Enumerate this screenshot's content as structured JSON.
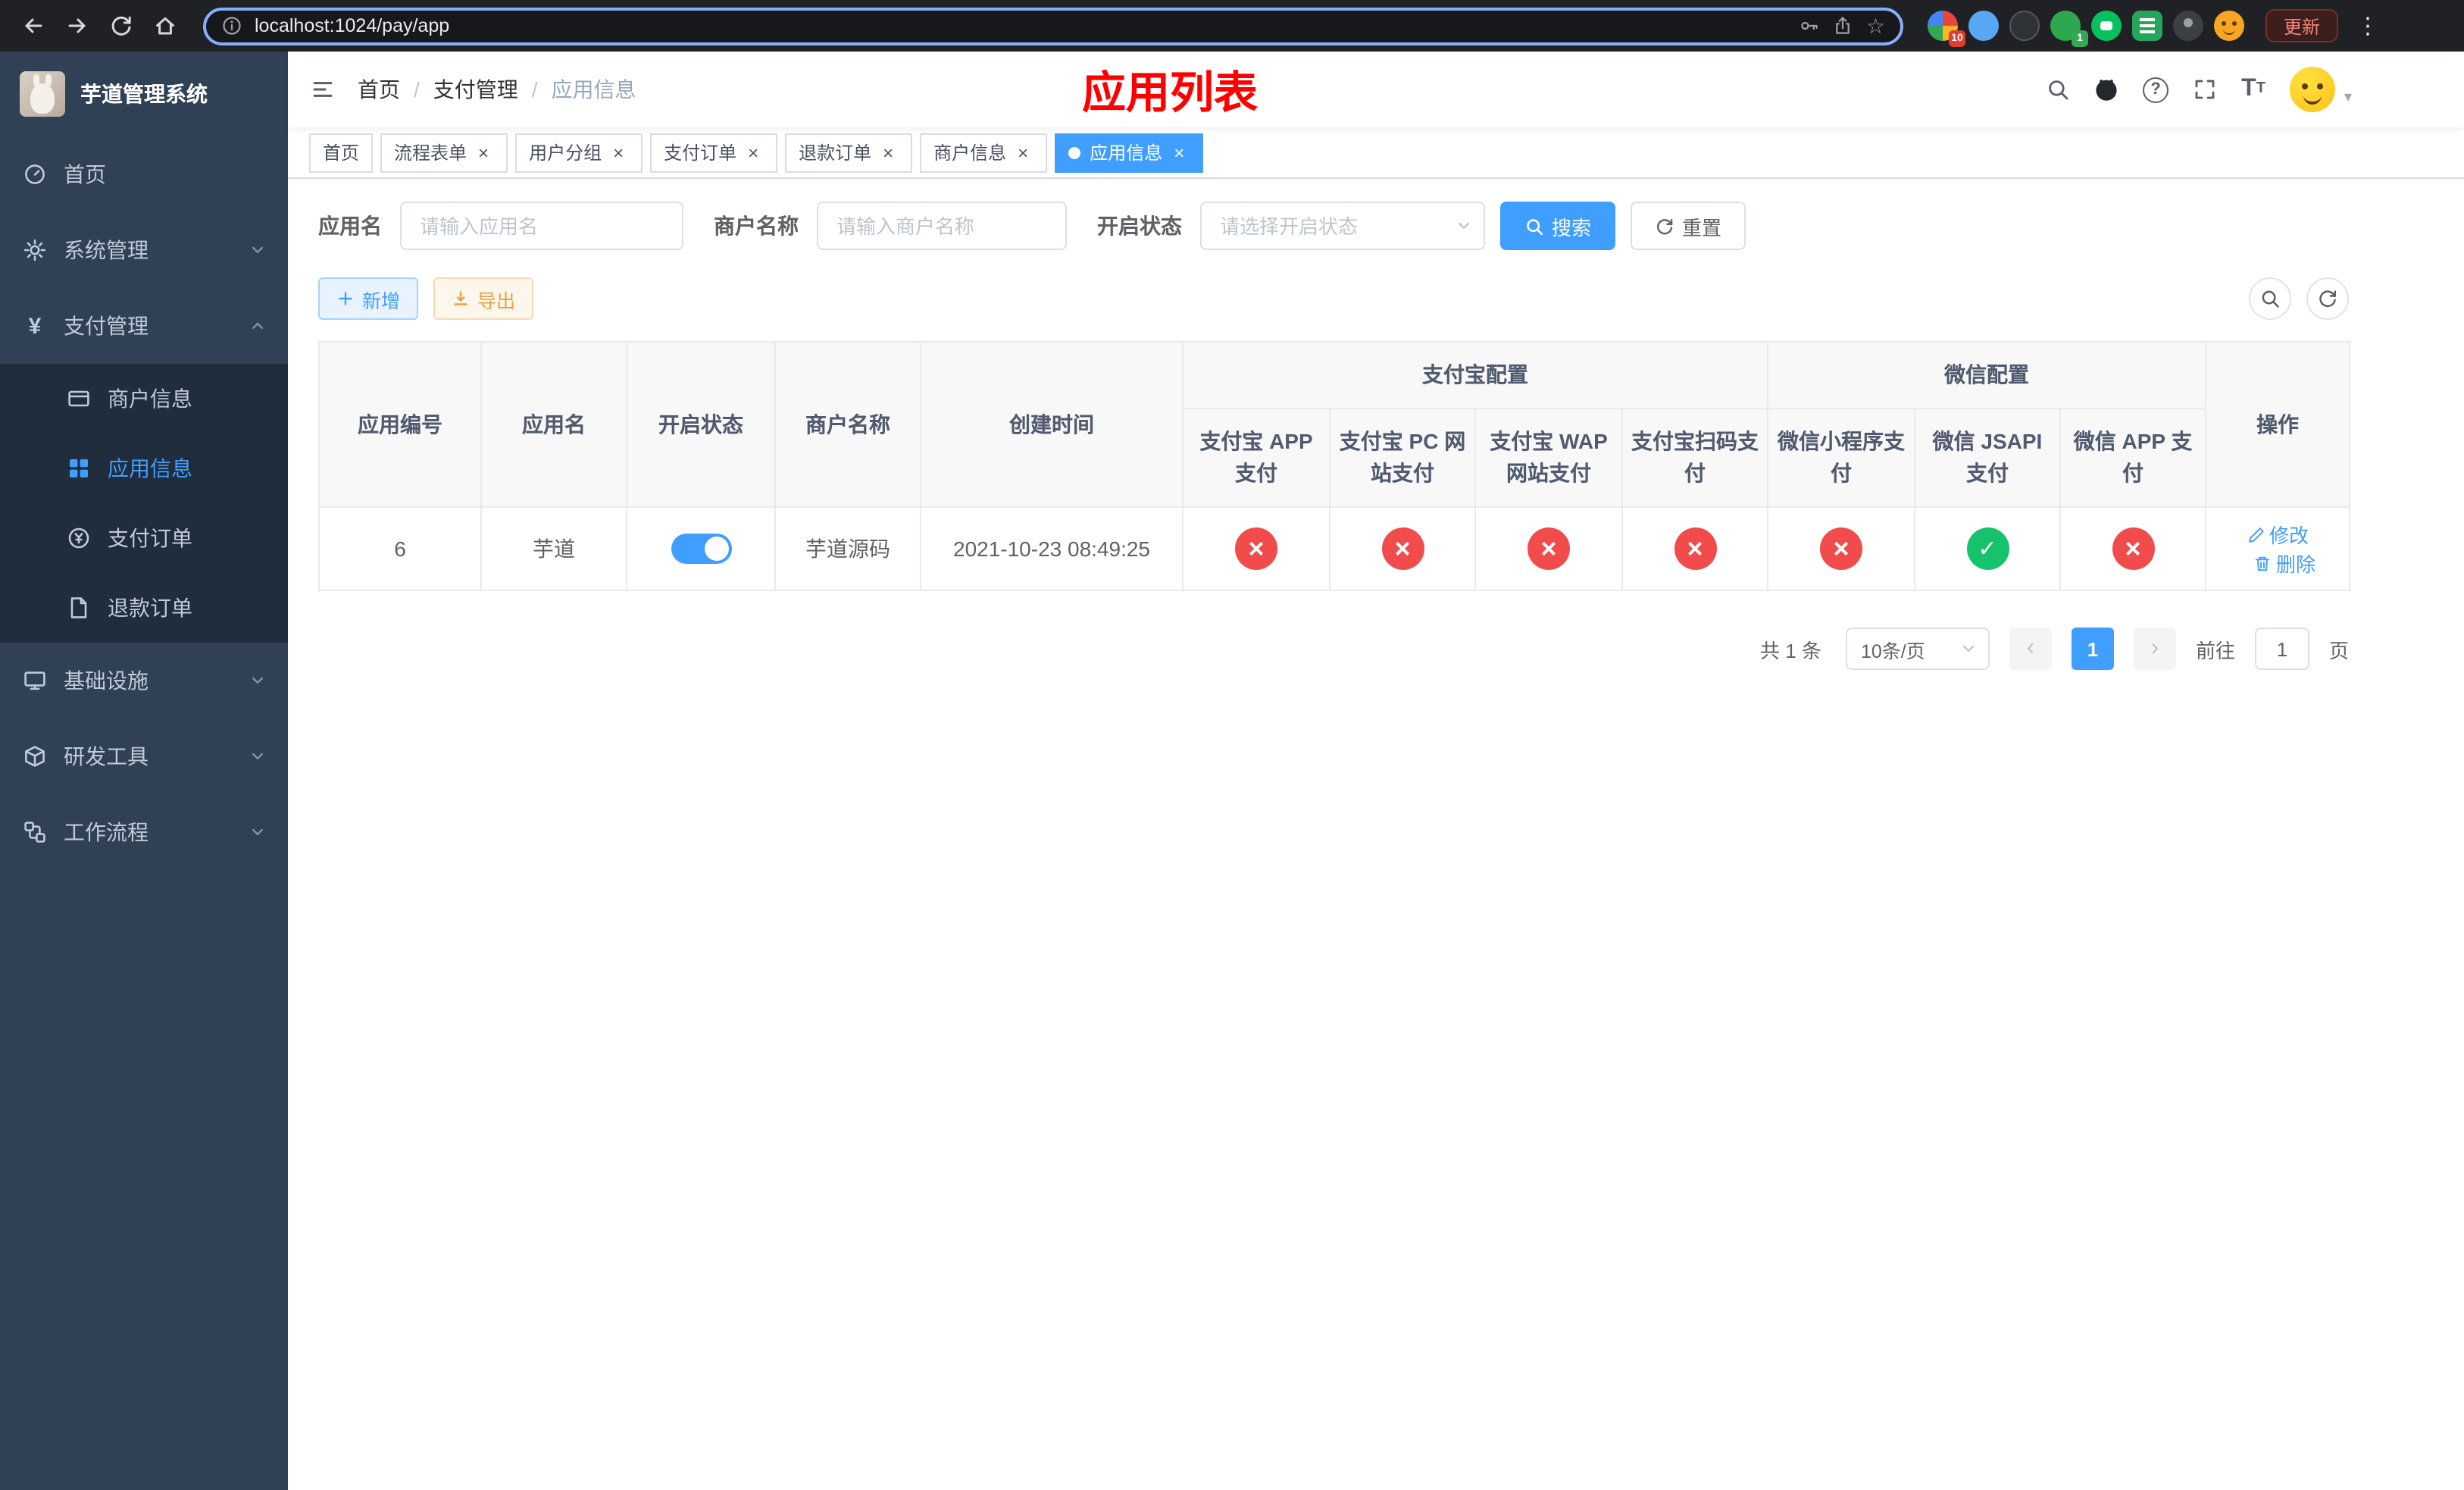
{
  "browser": {
    "url": "localhost:1024/pay/app",
    "update_label": "更新",
    "extension_badge_grid": "10",
    "extension_badge_leaf": "1",
    "icons": [
      "back",
      "forward",
      "refresh",
      "home",
      "info",
      "key",
      "share",
      "bookmark-star",
      "kebab-menu"
    ]
  },
  "sidebar": {
    "logo_title": "芋道管理系统",
    "items": [
      {
        "label": "首页",
        "icon": "dashboard"
      },
      {
        "label": "系统管理",
        "icon": "gear",
        "state": "collapsed"
      },
      {
        "label": "支付管理",
        "icon": "yen",
        "state": "expanded"
      },
      {
        "label": "基础设施",
        "icon": "monitor",
        "state": "collapsed"
      },
      {
        "label": "研发工具",
        "icon": "toolbox",
        "state": "collapsed"
      },
      {
        "label": "工作流程",
        "icon": "workflow",
        "state": "collapsed"
      }
    ],
    "payment_children": [
      {
        "label": "商户信息",
        "icon": "bank-card",
        "active": false
      },
      {
        "label": "应用信息",
        "icon": "app-grid",
        "active": true
      },
      {
        "label": "支付订单",
        "icon": "pay-order",
        "active": false
      },
      {
        "label": "退款订单",
        "icon": "refund-doc",
        "active": false
      }
    ]
  },
  "navbar": {
    "breadcrumb": [
      "首页",
      "支付管理",
      "应用信息"
    ],
    "page_title": "应用列表",
    "right_icons": [
      "search",
      "github",
      "help",
      "fullscreen",
      "font-size",
      "avatar"
    ]
  },
  "tabs": [
    {
      "label": "首页",
      "closable": false,
      "active": false
    },
    {
      "label": "流程表单",
      "closable": true,
      "active": false
    },
    {
      "label": "用户分组",
      "closable": true,
      "active": false
    },
    {
      "label": "支付订单",
      "closable": true,
      "active": false
    },
    {
      "label": "退款订单",
      "closable": true,
      "active": false
    },
    {
      "label": "商户信息",
      "closable": true,
      "active": false
    },
    {
      "label": "应用信息",
      "closable": true,
      "active": true
    }
  ],
  "filters": {
    "app_name_label": "应用名",
    "app_name_placeholder": "请输入应用名",
    "merchant_label": "商户名称",
    "merchant_placeholder": "请输入商户名称",
    "status_label": "开启状态",
    "status_placeholder": "请选择开启状态",
    "search_button": "搜索",
    "reset_button": "重置"
  },
  "toolbar": {
    "add_button": "新增",
    "export_button": "导出"
  },
  "table": {
    "groups": {
      "alipay": "支付宝配置",
      "wechat": "微信配置"
    },
    "columns": {
      "app_id": "应用编号",
      "app_name": "应用名",
      "status": "开启状态",
      "merchant": "商户名称",
      "created": "创建时间",
      "alipay_app": "支付宝 APP 支付",
      "alipay_pc": "支付宝 PC 网站支付",
      "alipay_wap": "支付宝 WAP 网站支付",
      "alipay_qr": "支付宝扫码支付",
      "wx_lite": "微信小程序支付",
      "wx_jsapi": "微信 JSAPI 支付",
      "wx_app": "微信 APP 支付",
      "actions": "操作"
    },
    "rows": [
      {
        "app_id": "6",
        "app_name": "芋道",
        "status_on": true,
        "merchant": "芋道源码",
        "created": "2021-10-23 08:49:25",
        "configs": [
          "no",
          "no",
          "no",
          "no",
          "no",
          "yes",
          "no"
        ],
        "edit_label": "修改",
        "delete_label": "删除"
      }
    ]
  },
  "pagination": {
    "total": "共 1 条",
    "page_size": "10条/页",
    "page": "1",
    "goto_prefix": "前往",
    "goto_value": "1",
    "goto_suffix": "页"
  },
  "colors": {
    "primary": "#409eff",
    "success": "#17c26d",
    "danger": "#f24b4b",
    "warning": "#e6a23c",
    "page_title_red": "#ff0000",
    "sidebar_bg": "#304156",
    "submenu_bg": "#1f2d3d"
  }
}
